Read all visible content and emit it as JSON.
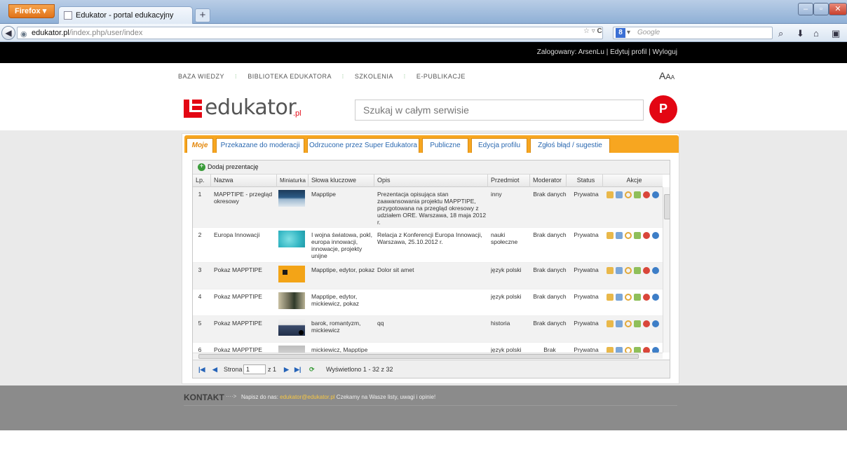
{
  "browser": {
    "menu_label": "Firefox",
    "tab_title": "Edukator - portal edukacyjny",
    "new_tab": "+",
    "url_host": "edukator.pl",
    "url_path": "/index.php/user/index",
    "search_engine_placeholder": "Google"
  },
  "top": {
    "logged_in_label": "Zalogowany: ArsenLu",
    "edit_profile": "Edytuj profil",
    "logout": "Wyloguj",
    "sep": "|"
  },
  "topnav": [
    "BAZA WIEDZY",
    "BIBLIOTEKA EDUKATORA",
    "SZKOLENIA",
    "E-PUBLIKACJE"
  ],
  "topnav_sep": "⁝",
  "font_size_controls": [
    "A",
    "A",
    "A"
  ],
  "logo": {
    "text": "edukator",
    "suffix": ".pl"
  },
  "search": {
    "placeholder": "Szukaj w całym serwisie",
    "button_icon": "search-p-icon"
  },
  "tabs": [
    {
      "label": "Moje",
      "active": true
    },
    {
      "label": "Przekazane do moderacji",
      "active": false
    },
    {
      "label": "Odrzucone przez Super Edukatora",
      "active": false
    },
    {
      "label": "Publiczne",
      "active": false
    },
    {
      "label": "Edycja profilu",
      "active": false
    },
    {
      "label": "Zgłoś błąd / sugestie",
      "active": false
    }
  ],
  "grid": {
    "add_label": "Dodaj prezentację",
    "columns": [
      "Lp.",
      "Nazwa",
      "Miniaturka",
      "Słowa kluczowe",
      "Opis",
      "Przedmiot",
      "Moderator",
      "Status",
      "Akcje"
    ],
    "rows": [
      {
        "lp": "1",
        "name": "MAPPTIPE - przegląd okresowy",
        "keywords": "Mapptipe",
        "desc": "Prezentacja opisująca stan zaawansowania projektu MAPPTIPE, przygotowana na przegląd okresowy z udziałem ORE. Warszawa, 18 maja 2012 r.",
        "subject": "inny",
        "moderator": "Brak danych",
        "status": "Prywatna",
        "thumb": "ocean"
      },
      {
        "lp": "2",
        "name": "Europa Innowacji",
        "keywords": "I wojna światowa, pokl, europa innowacji, innowacje, projekty unijne",
        "desc": "Relacja z Konferencji Europa Innowacji, Warszawa, 25.10.2012 r.",
        "subject": "nauki społeczne",
        "moderator": "Brak danych",
        "status": "Prywatna",
        "thumb": "teal"
      },
      {
        "lp": "3",
        "name": "Pokaz MAPPTIPE",
        "keywords": "Mapptipe, edytor, pokaz",
        "desc": "Dolor sit amet",
        "subject": "język polski",
        "moderator": "Brak danych",
        "status": "Prywatna",
        "thumb": "orange"
      },
      {
        "lp": "4",
        "name": "Pokaz MAPPTIPE",
        "keywords": "Mapptipe, edytor, mickiewicz, pokaz",
        "desc": "",
        "subject": "język polski",
        "moderator": "Brak danych",
        "status": "Prywatna",
        "thumb": "portrait"
      },
      {
        "lp": "5",
        "name": "Pokaz MAPPTIPE",
        "keywords": "barok, romantyzm, mickiewicz",
        "desc": "qq",
        "subject": "historia",
        "moderator": "Brak danych",
        "status": "Prywatna",
        "thumb": "landscape"
      },
      {
        "lp": "6",
        "name": "Pokaz MAPPTIPE",
        "keywords": "mickiewicz, Mapptipe",
        "desc": "",
        "subject": "język polski",
        "moderator": "Brak",
        "status": "Prywatna",
        "thumb": "gray"
      }
    ],
    "actions": [
      "preview-icon",
      "export-icon",
      "search-icon",
      "edit-icon",
      "delete-icon",
      "info-icon"
    ]
  },
  "pager": {
    "page_label": "Strona",
    "page_value": "1",
    "of_label": "z 1",
    "summary": "Wyświetlono 1 - 32 z 32"
  },
  "footer": {
    "title": "KONTAKT",
    "arrow": "····>",
    "prefix": "Napisz do nas:",
    "email": "edukator@edukator.pl",
    "suffix": "Czekamy na Wasze listy, uwagi i opinie!"
  },
  "colors": {
    "accent": "#f7a620",
    "brand_red": "#e30613",
    "link_blue": "#2a68b0"
  }
}
